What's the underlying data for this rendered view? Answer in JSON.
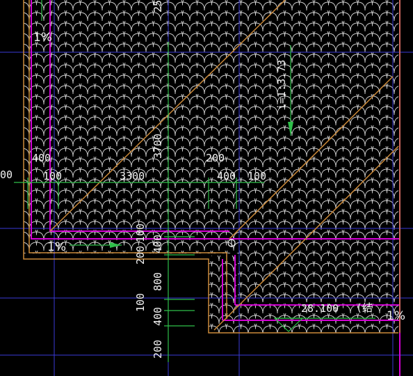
{
  "drawing": {
    "background": "#000000",
    "colors": {
      "tile": "#cfcfcf",
      "outline": "#cc8a3a",
      "wall": "#d400d4",
      "grid": "#3a3ad8",
      "dim_line": "#2fbf4a",
      "text": "#f2f2f2"
    },
    "dimensions": {
      "top_vertical": "25",
      "left_edge": "00",
      "d400_left": "400",
      "d100_left": "100",
      "d3300": "3300",
      "d3700": "3700",
      "d200_top": "200",
      "d400_mid": "400",
      "d100_mid": "100",
      "v100_a": "100",
      "v400_a": "400",
      "v200_a": "200",
      "v800": "800",
      "v100_b": "100",
      "v400_b": "400",
      "v200_b": "200"
    },
    "slopes": {
      "top_left": "1%",
      "mid_left": "1%",
      "bottom_right": "1%",
      "roof_slope": "i=1:3.73"
    },
    "elevation": {
      "value": "28.100",
      "note": "(结"
    }
  }
}
